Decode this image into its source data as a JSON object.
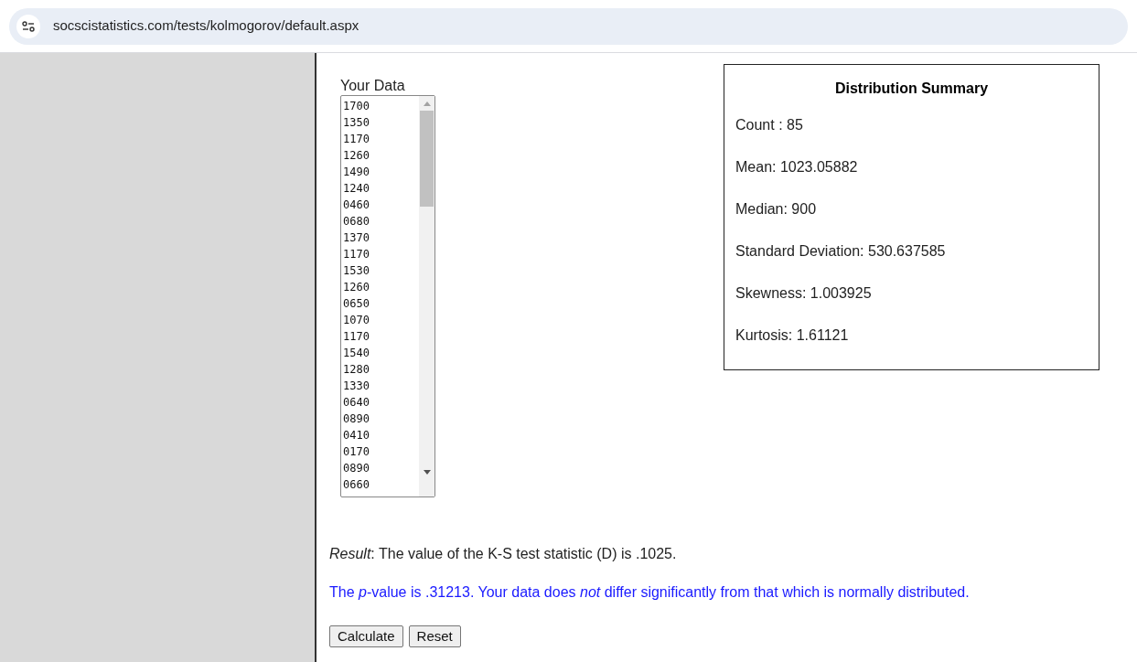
{
  "address_bar": {
    "url": "socscistatistics.com/tests/kolmogorov/default.aspx"
  },
  "data_input": {
    "label": "Your Data",
    "values": [
      "1700",
      "1350",
      "1170",
      "1260",
      "1490",
      "1240",
      "0460",
      "0680",
      "1370",
      "1170",
      "1530",
      "1260",
      "0650",
      "1070",
      "1170",
      "1540",
      "1280",
      "1330",
      "0640",
      "0890",
      "0410",
      "0170",
      "0890",
      "0660"
    ]
  },
  "summary": {
    "title": "Distribution Summary",
    "lines": [
      "Count : 85",
      "Mean: 1023.05882",
      "Median: 900",
      "Standard Deviation: 530.637585",
      "Skewness: 1.003925",
      "Kurtosis: 1.61121"
    ]
  },
  "result": "*Result*: The value of the K-S test statistic (D) is .1025.",
  "conclusion": "The *p*-value is .31213. Your data does *not* differ significantly from that which is normally distributed.",
  "buttons": [
    "Calculate",
    "Reset"
  ]
}
